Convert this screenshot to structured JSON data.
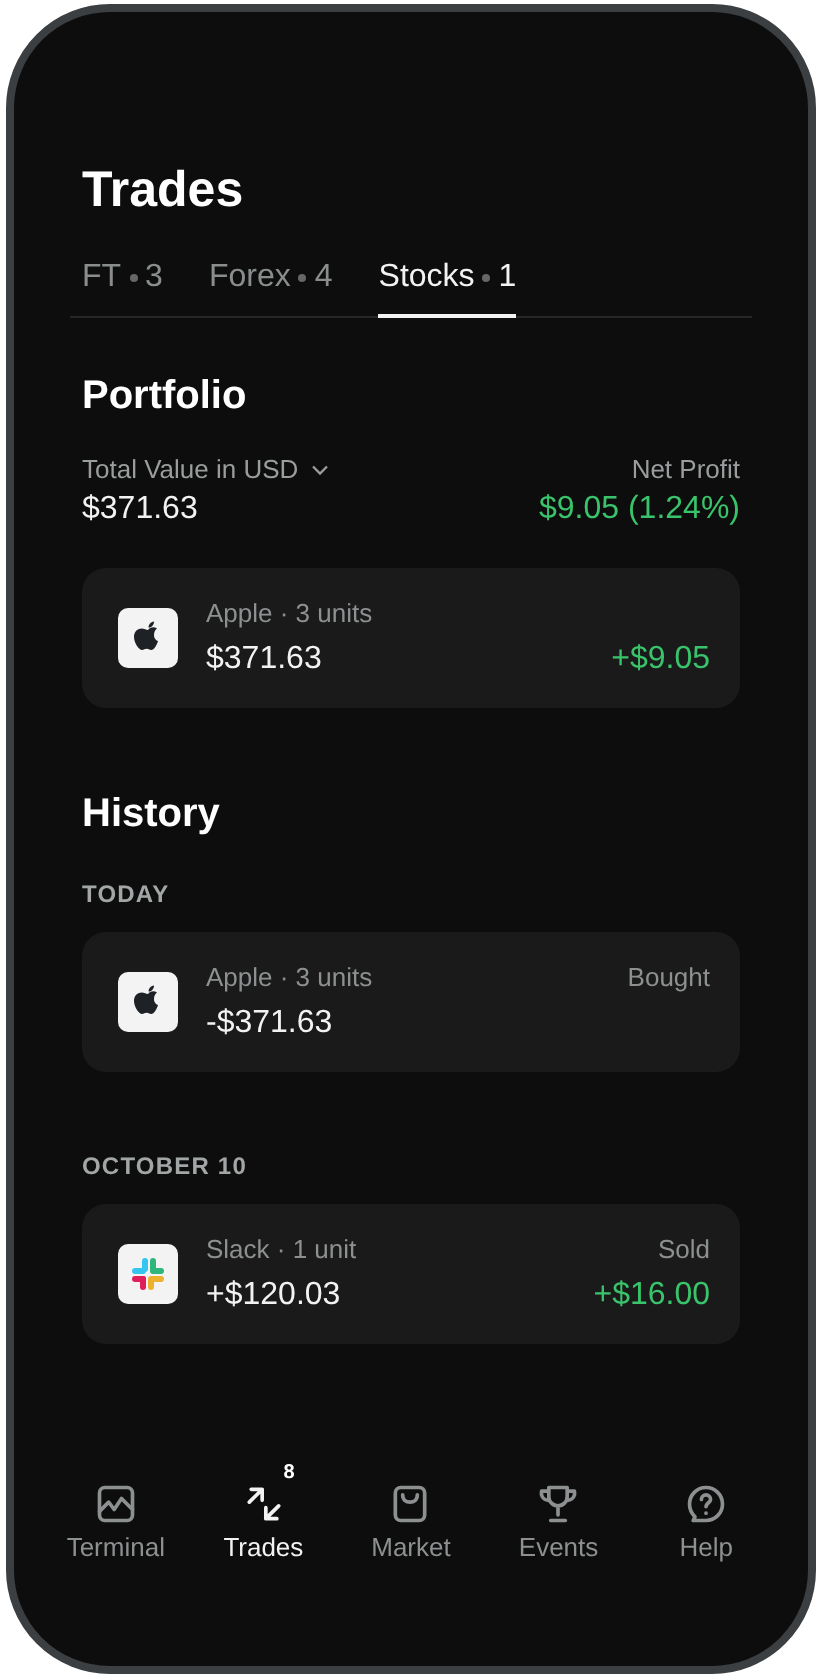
{
  "header": {
    "title": "Trades"
  },
  "tabs": [
    {
      "label": "FT",
      "count": "3",
      "selected": false
    },
    {
      "label": "Forex",
      "count": "4",
      "selected": false
    },
    {
      "label": "Stocks",
      "count": "1",
      "selected": true
    }
  ],
  "portfolio": {
    "title": "Portfolio",
    "total_label": "Total Value in USD",
    "total_value": "$371.63",
    "profit_label": "Net Profit",
    "profit_value": "$9.05 (1.24%)",
    "holdings": [
      {
        "kind": "apple",
        "name": "Apple · 3 units",
        "value": "$371.63",
        "profit": "+$9.05"
      }
    ]
  },
  "history": {
    "title": "History",
    "groups": [
      {
        "date": "TODAY",
        "trades": [
          {
            "kind": "apple",
            "name": "Apple · 3 units",
            "amount": "-$371.63",
            "action": "Bought"
          }
        ]
      },
      {
        "date": "OCTOBER 10",
        "trades": [
          {
            "kind": "slack",
            "name": "Slack · 1 unit",
            "amount": "+$120.03",
            "action": "Sold",
            "profit": "+$16.00"
          }
        ]
      }
    ]
  },
  "nav": [
    {
      "kind": "chart",
      "label": "Terminal",
      "selected": false
    },
    {
      "kind": "arrows",
      "label": "Trades",
      "badge": "8",
      "selected": true
    },
    {
      "kind": "bag",
      "label": "Market",
      "selected": false
    },
    {
      "kind": "trophy",
      "label": "Events",
      "selected": false
    },
    {
      "kind": "help",
      "label": "Help",
      "selected": false
    }
  ]
}
